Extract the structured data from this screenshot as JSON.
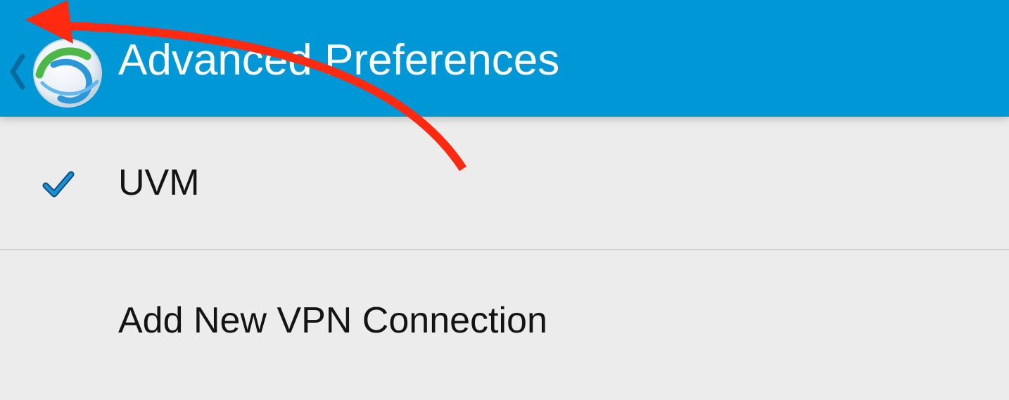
{
  "action_bar": {
    "title": "Advanced Preferences",
    "up_icon": "chevron-left-icon",
    "logo_icon": "anyconnect-globe-icon",
    "background": "#0097d6"
  },
  "list": {
    "items": [
      {
        "label": "UVM",
        "checked": true,
        "check_icon": "checkmark-icon",
        "check_color": "#1b8fd4"
      },
      {
        "label": "Add New VPN Connection",
        "checked": false
      }
    ]
  },
  "annotation": {
    "type": "curved-arrow",
    "icon": "red-arrow-icon",
    "color": "#ff2a10"
  }
}
